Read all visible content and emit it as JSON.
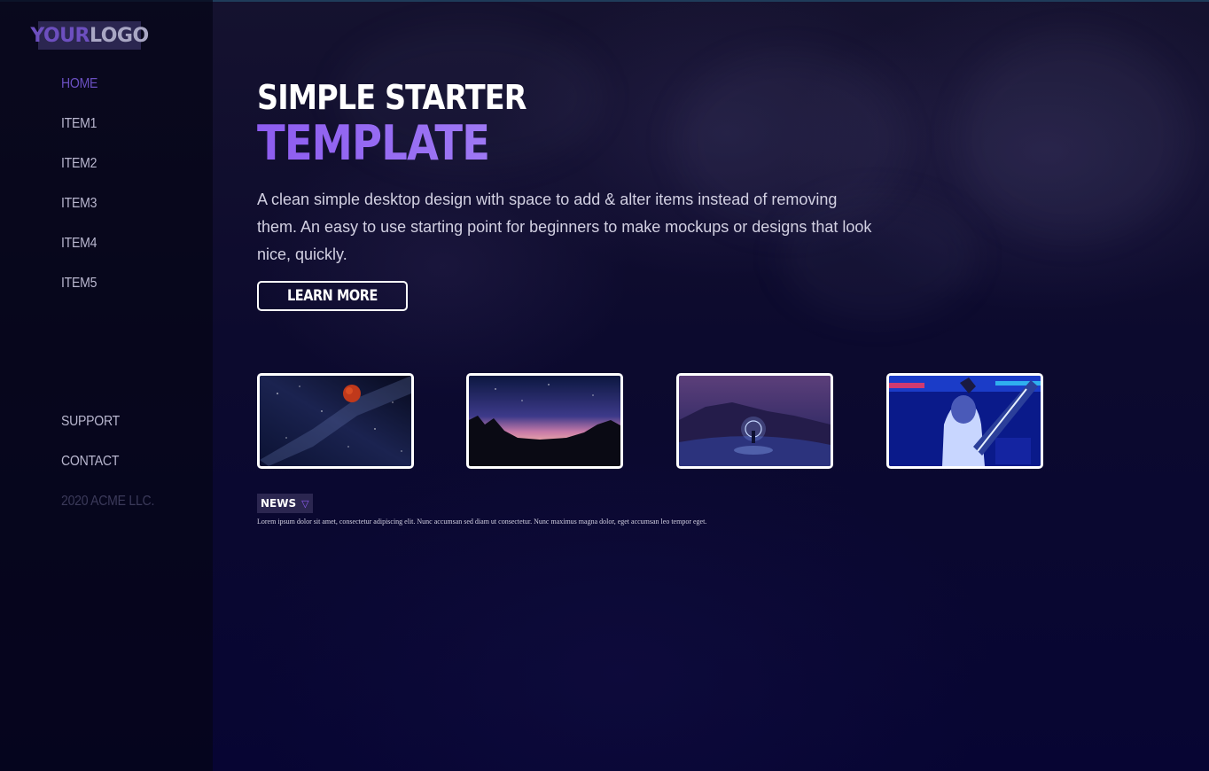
{
  "logo": {
    "part1": "YOUR",
    "part2": "LOGO"
  },
  "nav": {
    "items": [
      "HOME",
      "ITEM1",
      "ITEM2",
      "ITEM3",
      "ITEM4",
      "ITEM5"
    ],
    "active": "HOME"
  },
  "nav_bottom": {
    "support": "SUPPORT",
    "contact": "CONTACT",
    "copyright": "2020 ACME LLC."
  },
  "hero": {
    "title_line1": "SIMPLE STARTER",
    "title_line2": "TEMPLATE",
    "description": "A clean simple desktop design with space to add & alter items instead of removing them. An easy to use starting point for beginners to make mockups or designs that look nice, quickly.",
    "button_label": "LEARN MORE"
  },
  "thumbnails": [
    {
      "subject": "milky way with red moon"
    },
    {
      "subject": "rock silhouettes under pink night sky"
    },
    {
      "subject": "person with light in snowy night"
    },
    {
      "subject": "person with blue paint and guitar"
    }
  ],
  "news": {
    "label": "NEWS",
    "icon": "chevron-down-icon",
    "text": "Lorem ipsum dolor sit amet, consectetur adipiscing elit. Nunc accumsan sed diam ut consectetur. Nunc maximus magna dolor, eget accumsan leo tempor eget."
  },
  "colors": {
    "accent": "#8d5cf0",
    "background": "#07052a",
    "sidebar": "#060516"
  }
}
